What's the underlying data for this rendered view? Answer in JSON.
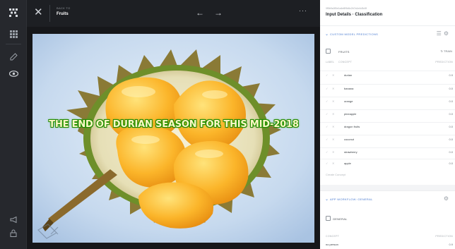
{
  "topbar": {
    "back_to": "BACK TO",
    "title": "Fruits",
    "more": "···"
  },
  "image": {
    "caption": "THE END OF DURIAN SEASON FOR THIS MID-2018"
  },
  "panel": {
    "input_id": "0f5b9a3f0e1a4e8f9d6c2b7a1e4d3c5f",
    "title": "Input Details · Classification",
    "custom_section": {
      "label": "CUSTOM MODEL PREDICTIONS",
      "model_name": "FRUITS",
      "train_label": "TRAIN",
      "col_label": "LABEL",
      "col_concept": "CONCEPT",
      "col_prediction": "PREDICTION",
      "concepts": [
        {
          "name": "durian",
          "value": "0.9"
        },
        {
          "name": "banana",
          "value": "0.0"
        },
        {
          "name": "orange",
          "value": "0.0"
        },
        {
          "name": "pineapple",
          "value": "0.0"
        },
        {
          "name": "dragon fruits",
          "value": "0.0"
        },
        {
          "name": "coconut",
          "value": "0.0"
        },
        {
          "name": "strawberry",
          "value": "0.0"
        },
        {
          "name": "apple",
          "value": "0.0"
        }
      ],
      "create_concept": "Create Concept"
    },
    "app_section": {
      "label": "APP WORKFLOW: GENERAL",
      "model_name": "GENERAL",
      "col_concept": "CONCEPT",
      "col_prediction": "PREDICTION",
      "first_concept": "no person",
      "first_value": "0.9"
    }
  },
  "colors": {
    "accent": "#4a7bd0",
    "rail_bg": "#26282d",
    "caption_glow": "#2aa000"
  }
}
